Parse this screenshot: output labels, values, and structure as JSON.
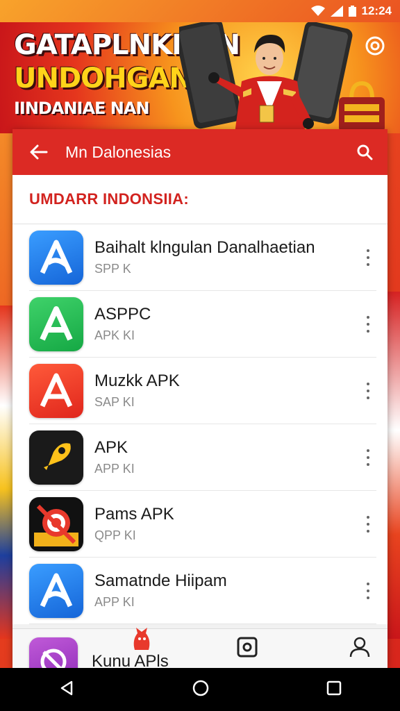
{
  "status_bar": {
    "time": "12:24"
  },
  "banner": {
    "line1": "GATAPLNKNON",
    "line2": "UNDOHGAN",
    "line3": "IINDANIAE NAN"
  },
  "appbar": {
    "title": "Mn Dalonesias"
  },
  "section": {
    "title": "UMDARR INDONSIIA:"
  },
  "apps": [
    {
      "name": "Baihalt klngulan Danalhaetian",
      "sub": "SPP K",
      "icon": "blue-a-icon"
    },
    {
      "name": "ASPPC",
      "sub": "APK KI",
      "icon": "green-a-icon"
    },
    {
      "name": "Muzkk APK",
      "sub": "SAP KI",
      "icon": "red-a-icon"
    },
    {
      "name": "APK",
      "sub": "APP KI",
      "icon": "rocket-icon"
    },
    {
      "name": "Pams APK",
      "sub": "QPP KI",
      "icon": "target-icon"
    },
    {
      "name": "Samatnde Hiipam",
      "sub": "APP KI",
      "icon": "blue-a-icon"
    }
  ],
  "partial_app": {
    "name": "Kunu APls",
    "icon": "purple-app-icon"
  },
  "colors": {
    "accent": "#dc2a24",
    "section_title": "#d2231f",
    "banner_yellow": "#ffd31a"
  }
}
